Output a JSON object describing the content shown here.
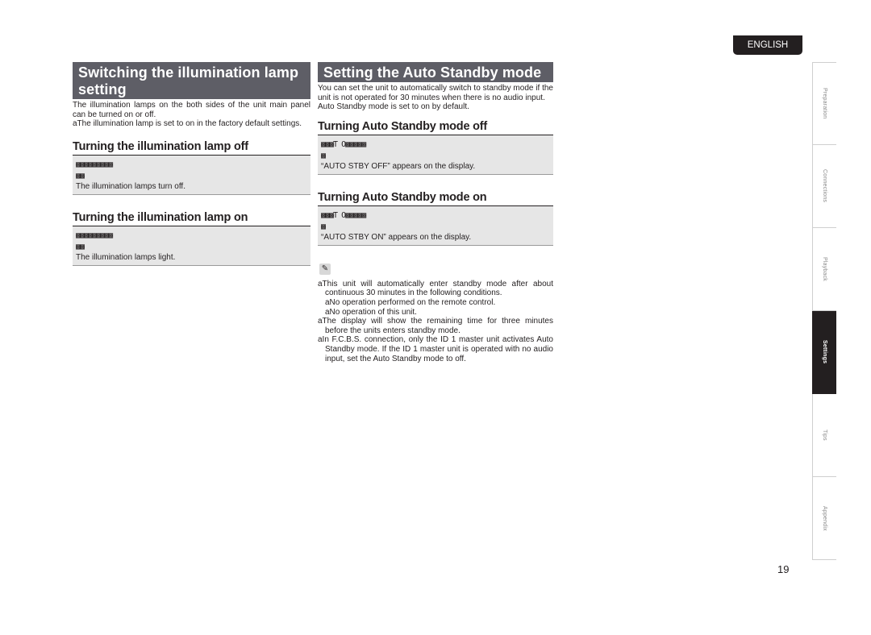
{
  "language_tab": "ENGLISH",
  "left": {
    "title": "Switching the illumination lamp setting",
    "intro": "The illumination lamps on the both sides of the unit main panel can be turned on or off.",
    "bullet": "aThe illumination lamp is set to on in the factory default settings.",
    "subsections": [
      {
        "heading": "Turning the illumination lamp off",
        "step1": "▩▩▩▩▩▩▩▩▩",
        "step2": "▩▩",
        "result": "The illumination lamps turn off."
      },
      {
        "heading": "Turning the illumination lamp on",
        "step1": "▩▩▩▩▩▩▩▩▩",
        "step2": "▩▩",
        "result": "The illumination lamps light."
      }
    ]
  },
  "right": {
    "title": "Setting the Auto Standby mode",
    "intro1": "You can set the unit to automatically switch to standby mode if the unit is not operated for 30 minutes when there is no audio input.",
    "intro2": "Auto Standby mode is set to on by default.",
    "subsections": [
      {
        "heading": "Turning Auto Standby mode off",
        "step1": "▩▩▩T O▩▩▩▩▩",
        "step2": "▩",
        "result": "“AUTO STBY OFF” appears on the display."
      },
      {
        "heading": "Turning Auto Standby mode on",
        "step1": "▩▩▩T O▩▩▩▩▩",
        "step2": "▩",
        "result": "“AUTO STBY ON” appears on the display."
      }
    ],
    "note_icon": "pencil-icon",
    "notes": [
      {
        "level": 1,
        "text": "aThis unit will automatically enter standby mode after about continuous 30 minutes in the following conditions."
      },
      {
        "level": 2,
        "text": "aNo operation performed on the remote control."
      },
      {
        "level": 2,
        "text": "aNo operation of this unit."
      },
      {
        "level": 1,
        "text": "aThe display will show the remaining time for three minutes before the units enters standby mode."
      },
      {
        "level": 1,
        "text": "aIn F.C.B.S. connection, only the ID 1 master unit activates Auto Standby mode. If the ID 1 master unit is operated with no audio input, set the Auto Standby mode to off."
      }
    ]
  },
  "side_tabs": [
    {
      "label": "Preparation",
      "active": false
    },
    {
      "label": "Connections",
      "active": false
    },
    {
      "label": "Playback",
      "active": false
    },
    {
      "label": "Settings",
      "active": true
    },
    {
      "label": "Tips",
      "active": false
    },
    {
      "label": "Appendix",
      "active": false
    }
  ],
  "page_number": "19"
}
